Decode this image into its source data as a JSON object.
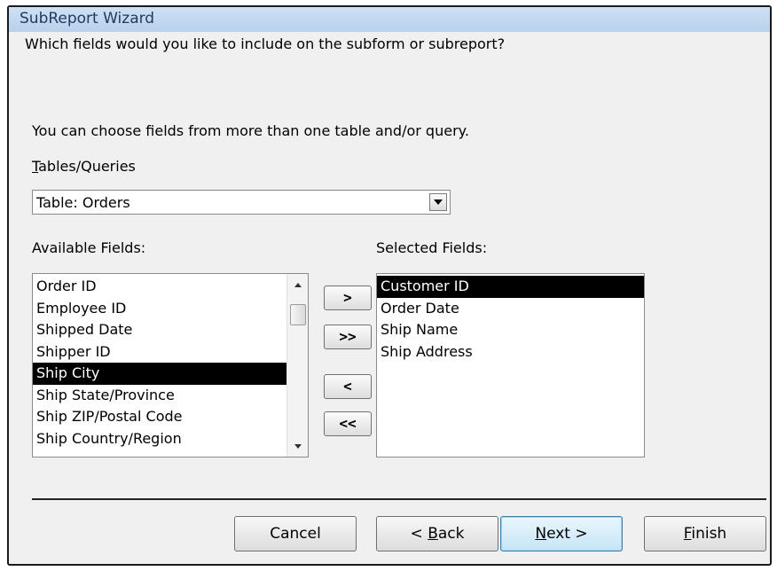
{
  "window": {
    "title": "SubReport Wizard"
  },
  "instructions": {
    "line1": "Which fields would you like to include on the subform or subreport?",
    "line2": "You can choose fields from more than one table and/or query."
  },
  "tables_queries": {
    "label": "Tables/Queries",
    "selected": "Table: Orders"
  },
  "available": {
    "label": "Available Fields:",
    "items": [
      "Order ID",
      "Employee ID",
      "Shipped Date",
      "Shipper ID",
      "Ship City",
      "Ship State/Province",
      "Ship ZIP/Postal Code",
      "Ship Country/Region"
    ],
    "selected_index": 4
  },
  "selected": {
    "label": "Selected Fields:",
    "items": [
      "Customer ID",
      "Order Date",
      "Ship Name",
      "Ship Address"
    ],
    "selected_index": 0
  },
  "move_buttons": {
    "add_one": ">",
    "add_all": ">>",
    "remove_one": "<",
    "remove_all": "<<"
  },
  "footer": {
    "cancel": "Cancel",
    "back": "< Back",
    "next": "Next >",
    "finish": "Finish"
  },
  "colors": {
    "title_text": "#1f3a5f",
    "selection": "#000000",
    "default_button": "#c7e5f6"
  },
  "icons": {
    "dropdown": "chevron-down-icon",
    "scroll_up": "scroll-up-icon",
    "scroll_down": "scroll-down-icon"
  }
}
